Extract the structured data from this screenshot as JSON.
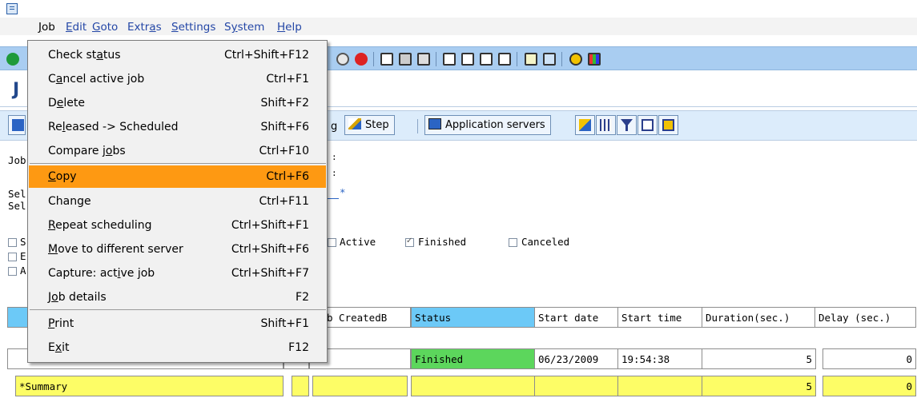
{
  "menubar": {
    "items": [
      {
        "pre": "",
        "u": "J",
        "post": "ob"
      },
      {
        "pre": "",
        "u": "E",
        "post": "dit"
      },
      {
        "pre": "",
        "u": "G",
        "post": "oto"
      },
      {
        "pre": "Extr",
        "u": "a",
        "post": "s"
      },
      {
        "pre": "",
        "u": "S",
        "post": "ettings"
      },
      {
        "pre": "S",
        "u": "y",
        "post": "stem"
      },
      {
        "pre": "",
        "u": "H",
        "post": "elp"
      }
    ]
  },
  "page": {
    "title_initial": "J"
  },
  "app_toolbar": {
    "partial_label": "g",
    "step_label": "Step",
    "app_servers_label": "Application servers"
  },
  "selection": {
    "labels": [
      "Job",
      "Sel",
      "Sel"
    ],
    "box_letters": [
      "S",
      "E",
      "A"
    ],
    "status_active": "Active",
    "status_finished": "Finished",
    "status_canceled": "Canceled",
    "finished_checked": true,
    "active_checked": false,
    "canceled_checked": false,
    "wildcard": "*"
  },
  "dropdown": {
    "items": [
      {
        "pre": "Check st",
        "u": "a",
        "post": "tus",
        "shortcut": "Ctrl+Shift+F12"
      },
      {
        "pre": "C",
        "u": "a",
        "post": "ncel active job",
        "shortcut": "Ctrl+F1"
      },
      {
        "pre": "D",
        "u": "e",
        "post": "lete",
        "shortcut": "Shift+F2"
      },
      {
        "pre": "Re",
        "u": "l",
        "post": "eased -> Scheduled",
        "shortcut": "Shift+F6"
      },
      {
        "pre": "Compare j",
        "u": "o",
        "post": "bs",
        "shortcut": "Ctrl+F10"
      },
      {
        "pre": "",
        "u": "C",
        "post": "opy",
        "shortcut": "Ctrl+F6"
      },
      {
        "pre": "Change",
        "u": "",
        "post": "",
        "shortcut": "Ctrl+F11"
      },
      {
        "pre": "",
        "u": "R",
        "post": "epeat scheduling",
        "shortcut": "Ctrl+Shift+F1"
      },
      {
        "pre": "",
        "u": "M",
        "post": "ove to different server",
        "shortcut": "Ctrl+Shift+F6"
      },
      {
        "pre": "Capture: act",
        "u": "i",
        "post": "ve job",
        "shortcut": "Ctrl+Shift+F7"
      },
      {
        "pre": "J",
        "u": "o",
        "post": "b details",
        "shortcut": "F2"
      },
      {
        "pre": "",
        "u": "P",
        "post": "rint",
        "shortcut": "Shift+F1"
      },
      {
        "pre": "E",
        "u": "x",
        "post": "it",
        "shortcut": "F12"
      }
    ],
    "highlighted": "Copy"
  },
  "table": {
    "headers": {
      "created_by": "b CreatedB",
      "status": "Status",
      "start_date": "Start date",
      "start_time": "Start time",
      "duration": "Duration(sec.)",
      "delay": "Delay (sec.)"
    },
    "row": {
      "status": "Finished",
      "start_date": "06/23/2009",
      "start_time": "19:54:38",
      "duration": "5",
      "delay": "0"
    },
    "summary": {
      "label": "*Summary",
      "duration": "5",
      "delay": "0"
    }
  },
  "colors": {
    "menu_highlight": "#fe9912",
    "header_bg": "#6cc9f7",
    "summary_bg": "#fdfd66",
    "status_finished": "#5cd65c",
    "toolbar_bg": "#a9cdf1"
  },
  "icons": [
    "window-icon",
    "enter-icon",
    "cancel-icon",
    "print-icon",
    "find-icon",
    "find-next-icon",
    "first-page-icon",
    "prev-page-icon",
    "next-page-icon",
    "last-page-icon",
    "create-session-icon",
    "shortcut-icon",
    "help-icon",
    "layout-icon",
    "step-icon",
    "application-servers-icon",
    "sort-icon",
    "grid-icon",
    "filter-icon",
    "print-list-icon",
    "sum-icon"
  ]
}
